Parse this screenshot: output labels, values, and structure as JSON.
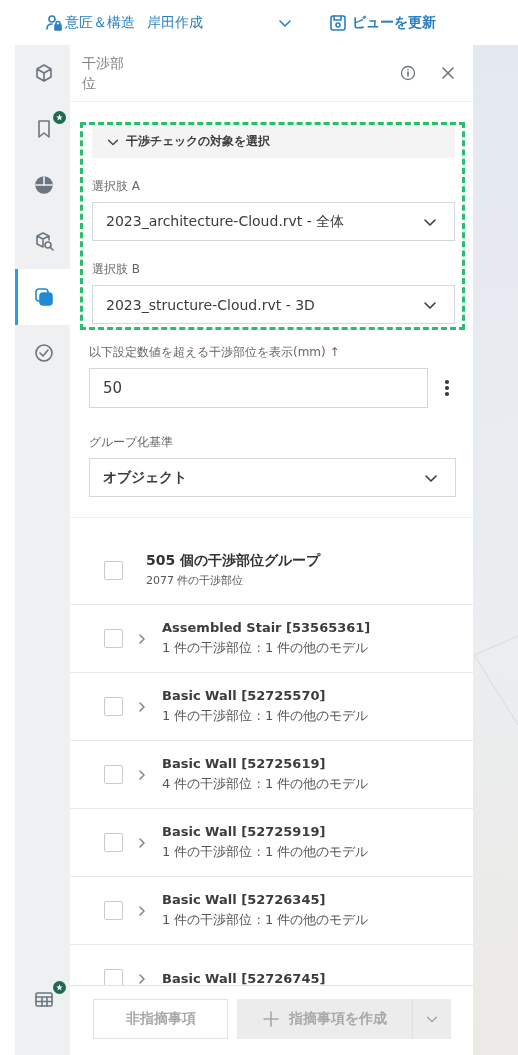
{
  "top_bar": {
    "project": "意匠＆構造",
    "author": "岸田作成",
    "save_button": "ビューを更新"
  },
  "rail": {
    "items": [
      {
        "selected": false,
        "badge": false
      },
      {
        "selected": false,
        "badge": true
      },
      {
        "selected": false,
        "badge": false
      },
      {
        "selected": false,
        "badge": false
      },
      {
        "selected": true,
        "badge": false
      },
      {
        "selected": false,
        "badge": false
      }
    ],
    "bottom_item": {
      "selected": false,
      "badge": true
    }
  },
  "panel": {
    "title": "干渉部位",
    "target_section": {
      "title": "干渉チェックの対象を選択",
      "expanded": true,
      "highlighted": true,
      "fields": [
        {
          "label": "選択肢 A",
          "value": "2023_architecture-Cloud.rvt - 全体"
        },
        {
          "label": "選択肢 B",
          "value": "2023_structure-Cloud.rvt - 3D"
        }
      ]
    },
    "threshold": {
      "label": "以下設定数値を超える干渉部位を表示(mm) ↑",
      "value": "50"
    },
    "grouping": {
      "label": "グループ化基準",
      "value": "オブジェクト"
    },
    "group_header": {
      "title": "505 個の干渉部位グループ",
      "subtitle": "2077 件の干渉部位",
      "checked": false
    },
    "rows": [
      {
        "title": "Assembled Stair [53565361]",
        "subtitle": "1 件の干渉部位 : 1 件の他のモデル",
        "checked": false
      },
      {
        "title": "Basic Wall [52725570]",
        "subtitle": "1 件の干渉部位 : 1 件の他のモデル",
        "checked": false
      },
      {
        "title": "Basic Wall [52725619]",
        "subtitle": "4 件の干渉部位 : 1 件の他のモデル",
        "checked": false
      },
      {
        "title": "Basic Wall [52725919]",
        "subtitle": "1 件の干渉部位 : 1 件の他のモデル",
        "checked": false
      },
      {
        "title": "Basic Wall [52726345]",
        "subtitle": "1 件の干渉部位 : 1 件の他のモデル",
        "checked": false
      },
      {
        "title": "Basic Wall [52726745]",
        "checked": false
      }
    ],
    "footer": {
      "secondary": {
        "label": "非指摘事項",
        "disabled": true
      },
      "primary": {
        "label": "指摘事項を作成",
        "disabled": true
      }
    }
  }
}
